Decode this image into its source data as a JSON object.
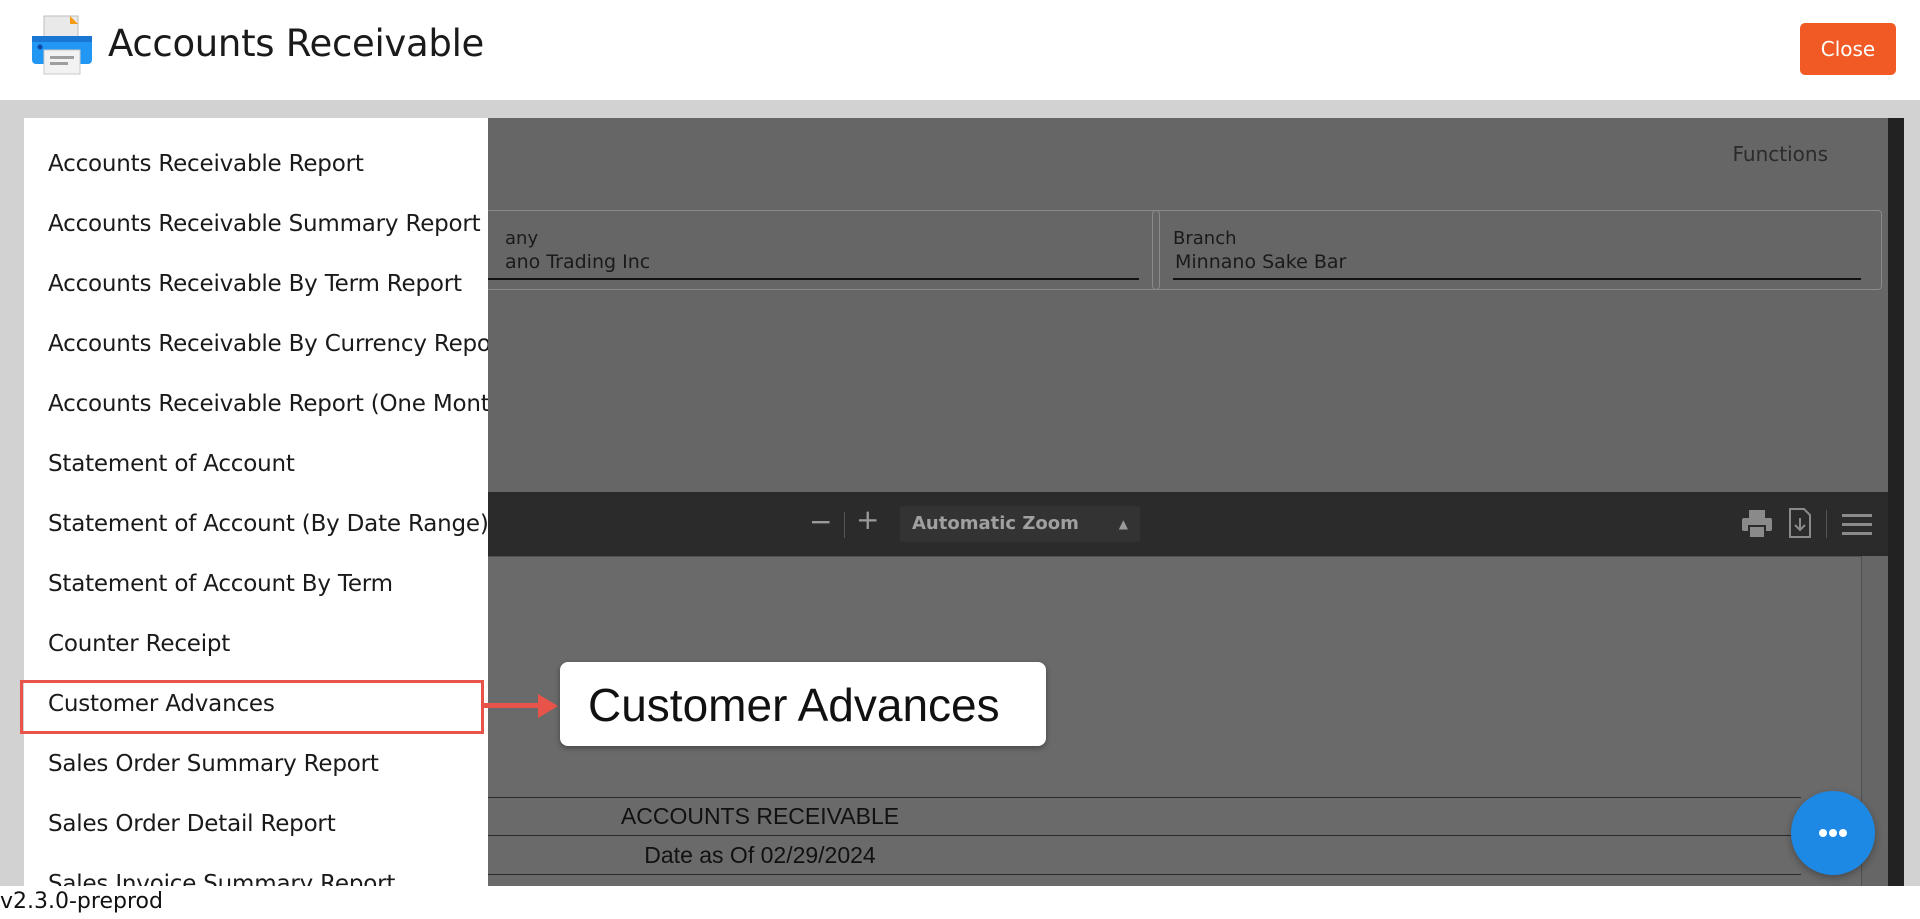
{
  "header": {
    "title": "Accounts Receivable",
    "close_label": "Close",
    "icon": "printer-icon"
  },
  "main": {
    "functions_label": "Functions",
    "company": {
      "label": "any",
      "value": "ano Trading Inc"
    },
    "branch": {
      "label": "Branch",
      "value": "Minnano Sake Bar"
    }
  },
  "viewer": {
    "zoom_minus": "−",
    "zoom_plus": "+",
    "zoom_value": "Automatic Zoom",
    "document": {
      "title": "ACCOUNTS RECEIVABLE",
      "date_line": "Date as Of 02/29/2024"
    }
  },
  "menu": {
    "items": [
      "Accounts Receivable Report",
      "Accounts Receivable Summary Report",
      "Accounts Receivable By Term Report",
      "Accounts Receivable By Currency Report",
      "Accounts Receivable Report (One Month)",
      "Statement of Account",
      "Statement of Account (By Date Range)",
      "Statement of Account By Term",
      "Counter Receipt",
      "Customer Advances",
      "Sales Order Summary Report",
      "Sales Order Detail Report",
      "Sales Invoice Summary Report"
    ],
    "highlighted": "Customer Advances"
  },
  "callout": {
    "text": "Customer Advances"
  },
  "footer": {
    "version": "v2.3.0-preprod"
  },
  "colors": {
    "close_button": "#f15a24",
    "highlight": "#e8534a",
    "fab": "#1e88e5"
  }
}
